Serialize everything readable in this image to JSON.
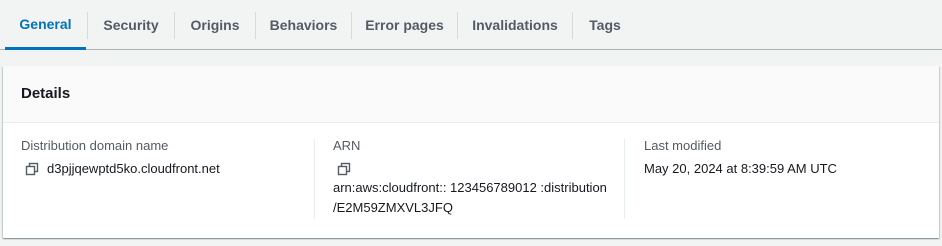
{
  "tabs": [
    {
      "label": "General",
      "active": true
    },
    {
      "label": "Security",
      "active": false
    },
    {
      "label": "Origins",
      "active": false
    },
    {
      "label": "Behaviors",
      "active": false
    },
    {
      "label": "Error pages",
      "active": false
    },
    {
      "label": "Invalidations",
      "active": false
    },
    {
      "label": "Tags",
      "active": false
    }
  ],
  "details": {
    "title": "Details",
    "domain": {
      "label": "Distribution domain name",
      "value": "d3pjjqewptd5ko.cloudfront.net",
      "icon": "copy-icon"
    },
    "arn": {
      "label": "ARN",
      "value_line1": "arn:aws:cloudfront:: 123456789012 :distribution",
      "value_line2": "/E2M59ZMXVL3JFQ",
      "icon": "copy-icon"
    },
    "last_modified": {
      "label": "Last modified",
      "value": "May 20, 2024 at 8:39:59 AM UTC"
    }
  },
  "colors": {
    "accent": "#0073bb",
    "tab_text": "#545b64",
    "body_text": "#16191f",
    "background": "#f2f3f3"
  }
}
